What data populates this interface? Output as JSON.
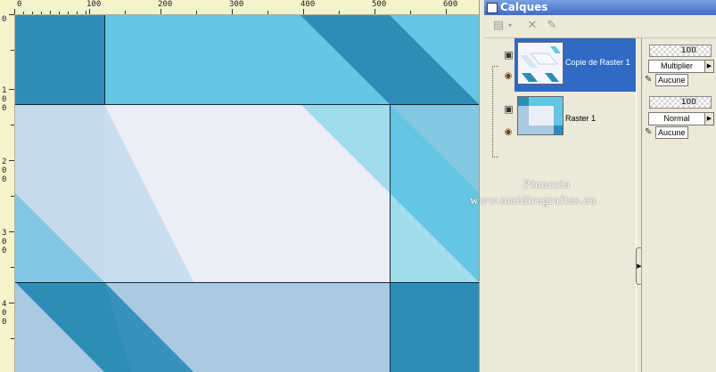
{
  "rulers": {
    "horizontal": [
      "0",
      "100",
      "200",
      "300",
      "400",
      "500",
      "600"
    ],
    "vertical": [
      "0",
      "1",
      "0",
      "0",
      "2",
      "0",
      "0",
      "3",
      "0",
      "0",
      "4",
      "0",
      "0"
    ]
  },
  "panel": {
    "title": "Calques",
    "toolbar": [
      "new-layer-icon",
      "dropdown-arrow-icon",
      "delete-layer-icon",
      "mask-icon"
    ]
  },
  "layers": [
    {
      "name": "Copie de Raster 1",
      "selected": true,
      "opacity": "100",
      "blend_mode": "Multiplier",
      "mask": "Aucune"
    },
    {
      "name": "Raster 1",
      "selected": false,
      "opacity": "100",
      "blend_mode": "Normal",
      "mask": "Aucune"
    }
  ],
  "watermark": {
    "line1": "Pinuccia",
    "line2": "www.maldiregraftes.eu"
  },
  "colors": {
    "dark_blue": "#2e8db7",
    "sky": "#64c6e2",
    "pale": "#eceef7",
    "light_blue": "#aac9e2",
    "selection": "#316ac5"
  }
}
